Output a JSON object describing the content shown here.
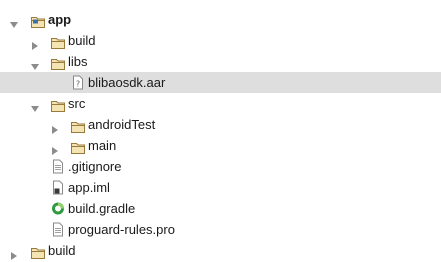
{
  "colors": {
    "folder_stroke": "#9a7a3a",
    "folder_fill": "#f4e4b4",
    "arrow": "#8c8c8c",
    "selection": "#dedede",
    "gradle_green": "#2e9a3e"
  },
  "tree": {
    "rows": [
      {
        "label": "app",
        "icon": "module-folder-icon",
        "expanded": true
      },
      {
        "label": "build",
        "icon": "folder-icon",
        "expanded": false
      },
      {
        "label": "libs",
        "icon": "folder-icon",
        "expanded": true
      },
      {
        "label": "blibaosdk.aar",
        "icon": "unknown-file-icon",
        "selected": true
      },
      {
        "label": "src",
        "icon": "folder-icon",
        "expanded": true
      },
      {
        "label": "androidTest",
        "icon": "folder-icon",
        "expanded": false
      },
      {
        "label": "main",
        "icon": "folder-icon",
        "expanded": false
      },
      {
        "label": ".gitignore",
        "icon": "text-file-icon"
      },
      {
        "label": "app.iml",
        "icon": "iml-file-icon"
      },
      {
        "label": "build.gradle",
        "icon": "gradle-icon"
      },
      {
        "label": "proguard-rules.pro",
        "icon": "text-file-icon"
      },
      {
        "label": "build",
        "icon": "folder-icon",
        "expanded": false
      }
    ]
  }
}
